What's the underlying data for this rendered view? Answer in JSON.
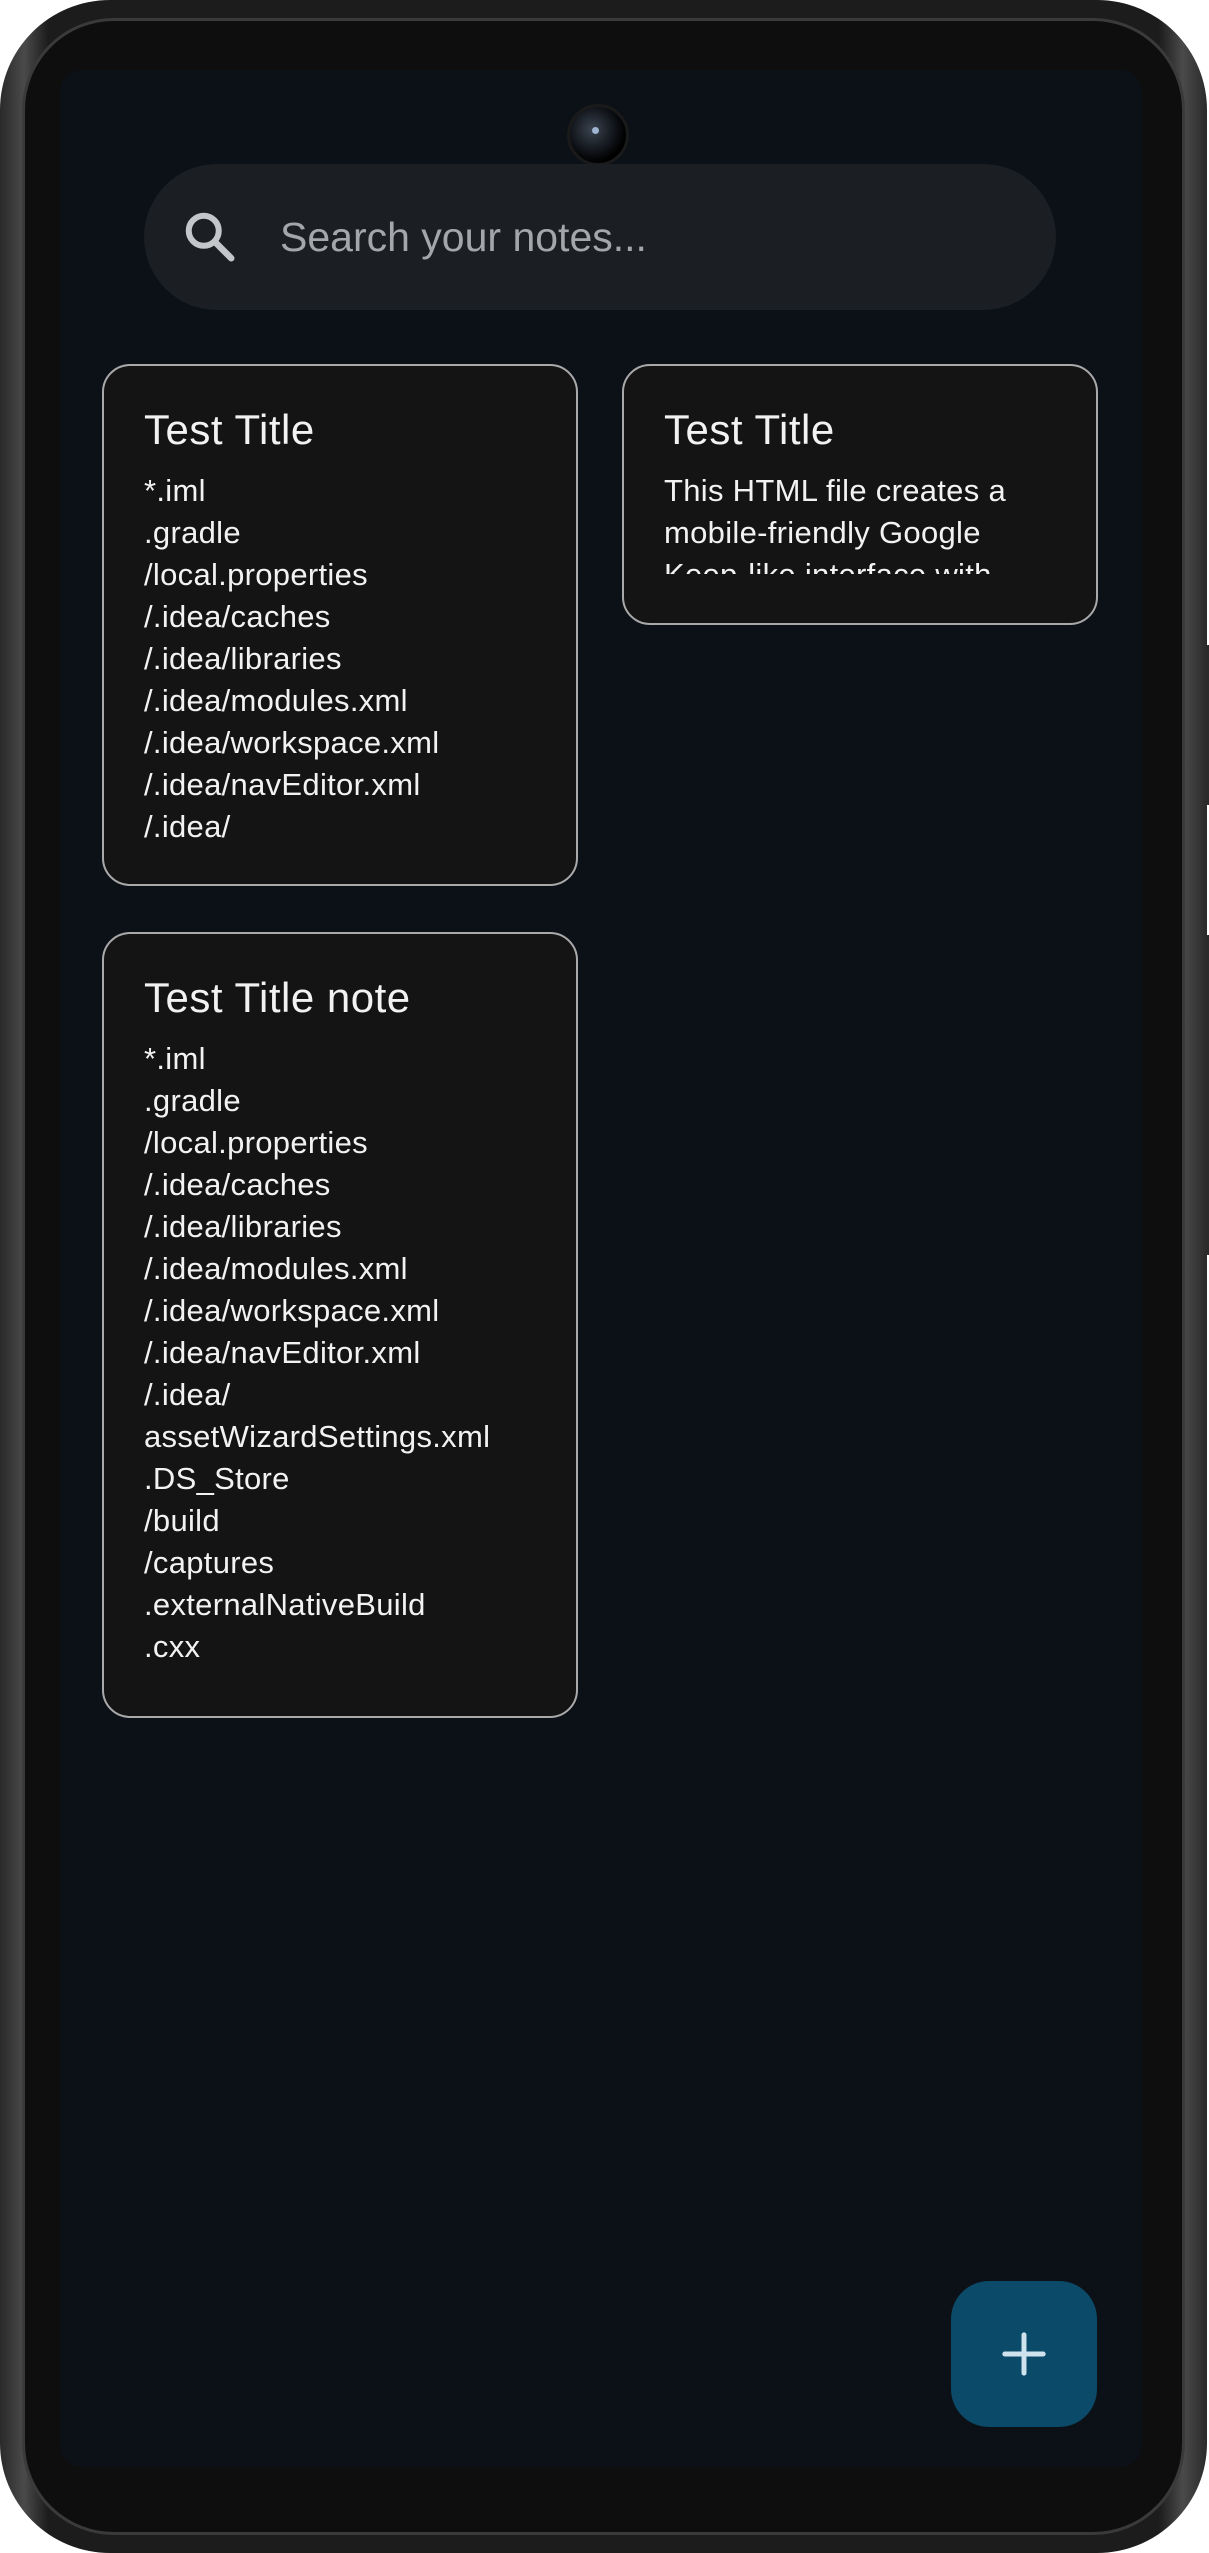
{
  "search": {
    "placeholder": "Search your notes..."
  },
  "notes": [
    {
      "title": "Test Title",
      "body": "*.iml\n.gradle\n/local.properties\n/.idea/caches\n/.idea/libraries\n/.idea/modules.xml\n/.idea/workspace.xml\n/.idea/navEditor.xml\n/.idea/"
    },
    {
      "title": "Test Title",
      "body": "This HTML file creates a mobile-friendly Google Keep-like interface with"
    },
    {
      "title": "Test Title note",
      "body": "*.iml\n.gradle\n/local.properties\n/.idea/caches\n/.idea/libraries\n/.idea/modules.xml\n/.idea/workspace.xml\n/.idea/navEditor.xml\n/.idea/\nassetWizardSettings.xml\n.DS_Store\n/build\n/captures\n.externalNativeBuild\n.cxx"
    }
  ],
  "fab": {
    "icon": "plus-icon"
  },
  "colors": {
    "background": "#0b1117",
    "search_bg": "#1b1f23",
    "card_bg": "#141414",
    "card_border": "#a9a9a9",
    "fab_bg": "#0b4a68",
    "fab_icon": "#cfe3ee"
  }
}
